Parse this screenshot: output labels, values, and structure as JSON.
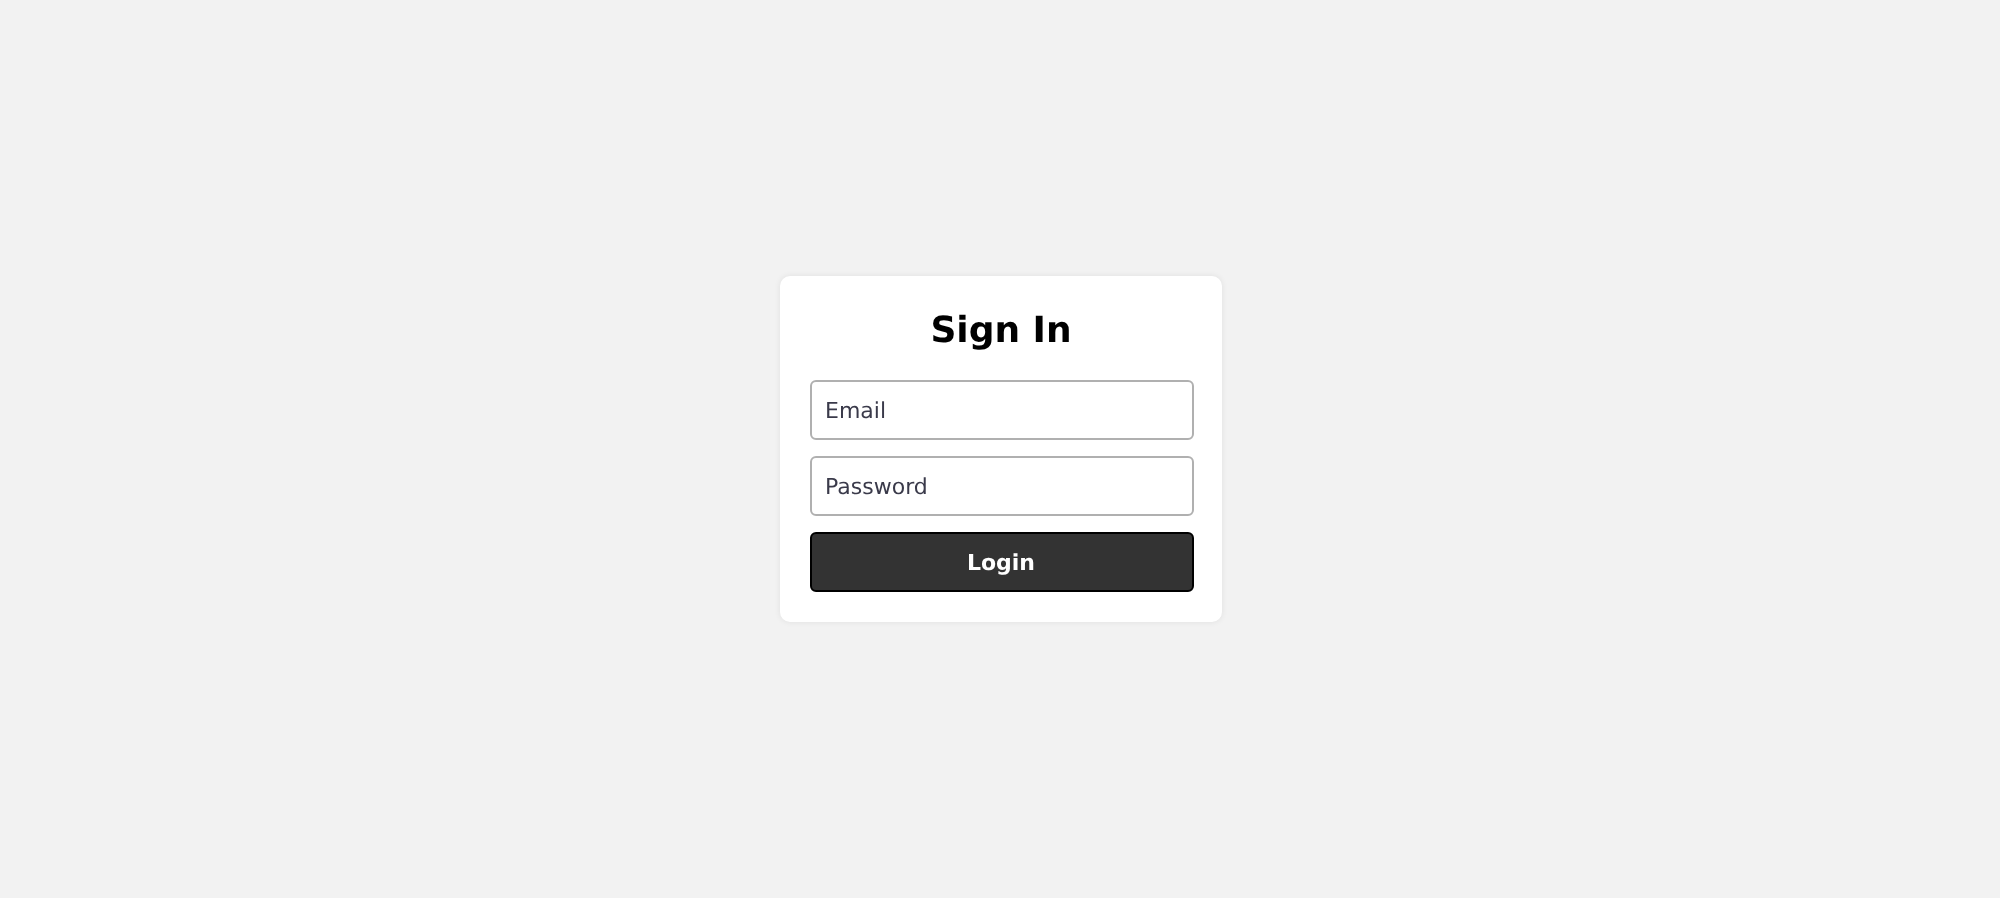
{
  "form": {
    "title": "Sign In",
    "fields": [
      {
        "placeholder": "Email"
      },
      {
        "placeholder": "Password"
      }
    ],
    "submit": "Login"
  }
}
